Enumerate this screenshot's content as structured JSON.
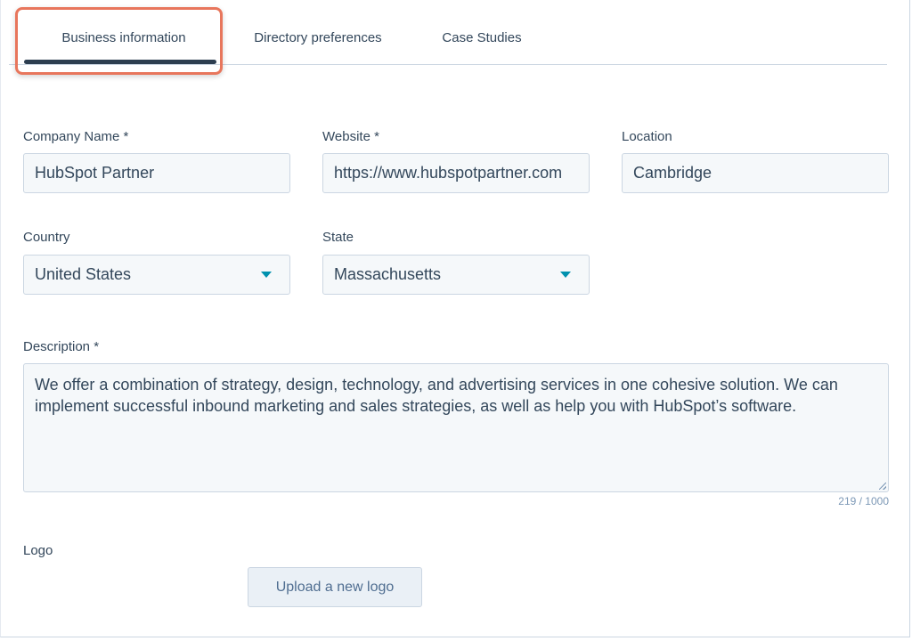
{
  "tabs": [
    {
      "label": "Business information",
      "active": true
    },
    {
      "label": "Directory preferences",
      "active": false
    },
    {
      "label": "Case Studies",
      "active": false
    }
  ],
  "form": {
    "company_name": {
      "label": "Company Name *",
      "value": "HubSpot Partner"
    },
    "website": {
      "label": "Website *",
      "value": "https://www.hubspotpartner.com"
    },
    "location": {
      "label": "Location",
      "value": "Cambridge"
    },
    "country": {
      "label": "Country",
      "value": "United States"
    },
    "state": {
      "label": "State",
      "value": "Massachusetts"
    },
    "description": {
      "label": "Description *",
      "value": "We offer a combination of strategy, design, technology, and advertising services in one cohesive solution. We can implement successful inbound marketing and sales strategies, as well as help you with HubSpot’s software.",
      "counter": "219 / 1000"
    },
    "logo": {
      "label": "Logo",
      "upload_label": "Upload a new logo"
    }
  },
  "colors": {
    "accent": "#0091ae",
    "highlight": "#e8765c",
    "tab_underline": "#2d3e50",
    "field_bg": "#f5f8fa",
    "text": "#33475b"
  }
}
